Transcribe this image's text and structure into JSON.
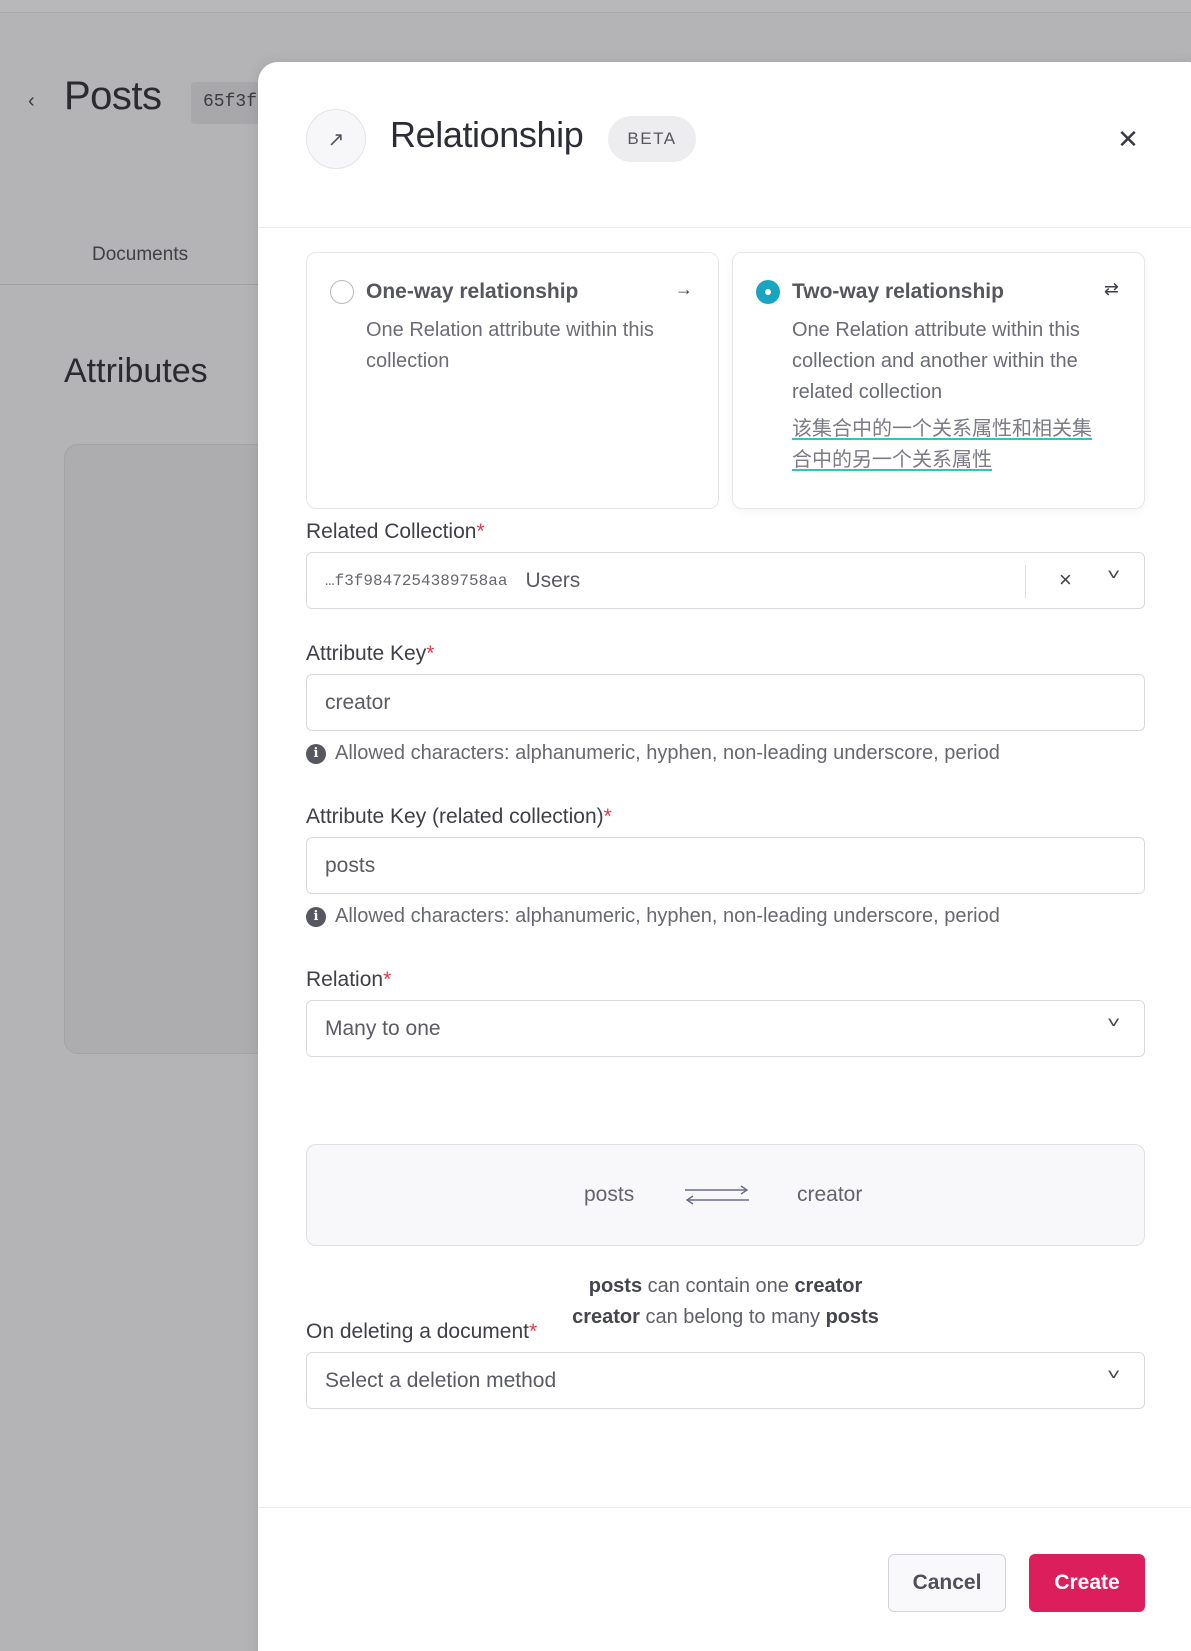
{
  "background": {
    "back_icon": "chevron-left-icon",
    "page_title": "Posts",
    "collection_id": "65f3f",
    "tab": "Documents",
    "section_title": "Attributes"
  },
  "modal": {
    "header_icon": "arrow-up-right-icon",
    "title": "Relationship",
    "badge": "BETA",
    "close_icon": "close-icon",
    "options": [
      {
        "title": "One-way relationship",
        "description": "One Relation attribute within this collection",
        "selected": false,
        "icon": "arrow-right-icon"
      },
      {
        "title": "Two-way relationship",
        "description": "One Relation attribute within this collection and another within the related collection",
        "translation": "该集合中的一个关系属性和相关集合中的另一个关系属性",
        "selected": true,
        "icon": "swap-arrows-icon"
      }
    ],
    "related_collection": {
      "label": "Related Collection",
      "required": "*",
      "id_value": "…f3f9847254389758aa",
      "name_value": "Users"
    },
    "attribute_key": {
      "label": "Attribute Key",
      "required": "*",
      "value": "creator",
      "hint": "Allowed characters: alphanumeric, hyphen, non-leading underscore, period"
    },
    "attribute_key_related": {
      "label": "Attribute Key (related collection)",
      "required": "*",
      "value": "posts",
      "hint": "Allowed characters: alphanumeric, hyphen, non-leading underscore, period"
    },
    "relation": {
      "label": "Relation",
      "required": "*",
      "value": "Many to one"
    },
    "diagram": {
      "left": "posts",
      "right": "creator"
    },
    "summary": {
      "line1": [
        "posts",
        " can contain one ",
        "creator"
      ],
      "line2": [
        "creator",
        " can belong to many ",
        "posts"
      ]
    },
    "on_delete": {
      "label": "On deleting a document",
      "required": "*",
      "placeholder": "Select a deletion method"
    },
    "buttons": {
      "cancel": "Cancel",
      "create": "Create"
    },
    "colors": {
      "accent": "#19a5c0",
      "primary_button": "#dc1e5c",
      "required": "#e03a4f"
    }
  }
}
